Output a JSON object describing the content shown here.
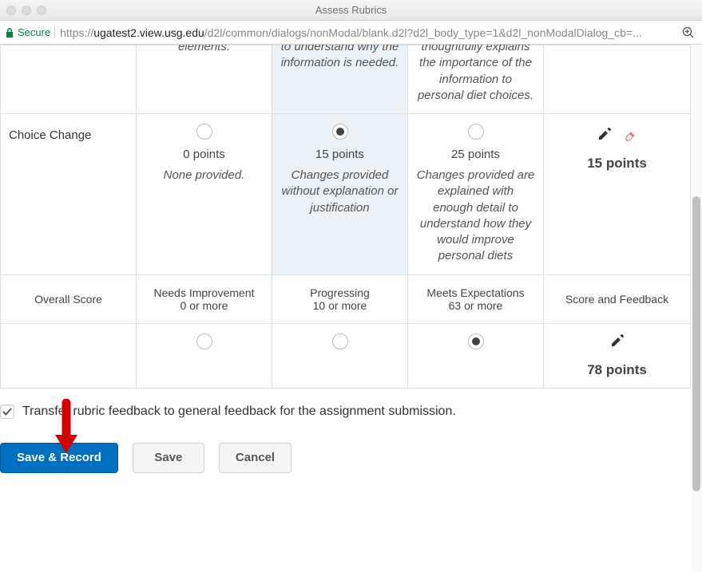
{
  "window": {
    "title": "Assess Rubrics"
  },
  "addressBar": {
    "secure_label": "Secure",
    "protocol": "https://",
    "host": "ugatest2.view.usg.edu",
    "path": "/d2l/common/dialogs/nonModal/blank.d2l?d2l_body_type=1&d2l_nonModalDialog_cb=..."
  },
  "rubric": {
    "row0": {
      "col0_desc": "elements.",
      "col1_desc": "to understand why the information is needed.",
      "col2_desc": "thoughtfully explains the importance of the information to personal diet choices."
    },
    "row1": {
      "name": "Choice Change",
      "col0_points": "0 points",
      "col0_desc": "None provided.",
      "col1_points": "15 points",
      "col1_desc": "Changes provided without explanation or justification",
      "col2_points": "25 points",
      "col2_desc": "Changes provided are explained with enough detail to understand how they would improve personal diets",
      "score": "15 points"
    },
    "overall": {
      "label": "Overall Score",
      "col0_title": "Needs Improvement",
      "col0_range": "0 or more",
      "col1_title": "Progressing",
      "col1_range": "10 or more",
      "col2_title": "Meets Expectations",
      "col2_range": "63 or more",
      "feedback_label": "Score and Feedback",
      "total_score": "78 points"
    }
  },
  "transfer": {
    "label": "Transfer rubric feedback to general feedback for the assignment submission."
  },
  "buttons": {
    "save_record": "Save & Record",
    "save": "Save",
    "cancel": "Cancel"
  }
}
